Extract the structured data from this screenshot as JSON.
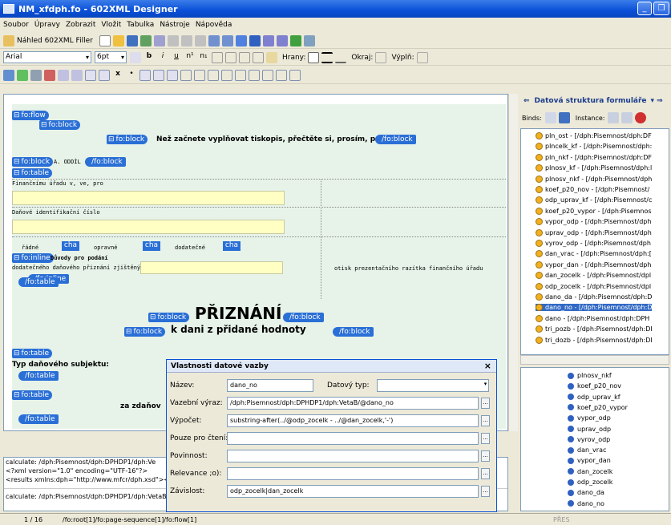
{
  "window": {
    "title": "NM_xfdph.fo - 602XML Designer"
  },
  "menu": [
    "Soubor",
    "Úpravy",
    "Zobrazit",
    "Vložit",
    "Tabulka",
    "Nástroje",
    "Nápověda"
  ],
  "toolbar1": {
    "preview_label": "Náhled 602XML Filler"
  },
  "toolbar2": {
    "font": "Arial",
    "size": "6pt",
    "borders_label": "Hrany:",
    "margin_label": "Okraj:",
    "fill_label": "Výplň:"
  },
  "editor": {
    "tags": {
      "flow": "fo:flow",
      "block": "fo:block",
      "block_end": "/fo:block",
      "table": "fo:table",
      "table_end": "/fo:table",
      "inline": "fo:inline",
      "inline_end": "/fo:inline"
    },
    "intro_text": "Než začnete vyplňovat tiskopis, přečtěte si, prosím, pokyny.",
    "section_a": "A. ODDÍL",
    "financni_urad": "Finančnímu úřadu v, ve, pro",
    "dic": "Daňové identifikační číslo",
    "radne": "řádné",
    "opravne": "opravné",
    "dodatecne": "dodatečné",
    "cha": "cha",
    "duvody": "Důvody pro podání",
    "dodatecne_zjisteny": "dodatečného daňového přiznání zjištěný",
    "otisk": "otisk prezentačního razítka finančního úřadu",
    "priznani": "PŘIZNÁNÍ",
    "k_dani": "k dani z přidané hodnoty",
    "typ_subjektu": "Typ daňového subjektu:",
    "za_zdanovaci": "za zdaňov"
  },
  "dialog": {
    "title": "Vlastnosti datové vazby",
    "close": "×",
    "name_label": "Název:",
    "name_value": "dano_no",
    "datatype_label": "Datový typ:",
    "datatype_value": "",
    "binding_label": "Vazební výraz:",
    "binding_value": "/dph:Pisemnost/dph:DPHDP1/dph:VetaB/@dano_no",
    "calc_label": "Výpočet:",
    "calc_value": "substring-after(../@odp_zocelk - ../@dan_zocelk,'-')",
    "readonly_label": "Pouze pro čtení:",
    "readonly_value": "",
    "required_label": "Povinnost:",
    "required_value": "",
    "relevance_label": "Relevance ;o):",
    "relevance_value": "",
    "dependency_label": "Závislost:",
    "dependency_value": "odp_zocelk|dan_zocelk",
    "browse": "..."
  },
  "rightpanel": {
    "title": "Datová struktura formuláře",
    "binds_label": "Binds:",
    "instance_label": "Instance:",
    "tree": [
      "pln_ost - [/dph:Pisemnost/dph:DF",
      "plncelk_kf - [/dph:Pisemnost/dph:",
      "pln_nkf - [/dph:Pisemnost/dph:DF",
      "plnosv_kf - [/dph:Pisemnost/dph:l",
      "plnosv_nkf - [/dph:Pisemnost/dph",
      "koef_p20_nov - [/dph:Pisemnost/",
      "odp_uprav_kf - [/dph:Pisemnost/c",
      "koef_p20_vypor - [/dph:Pisemnos",
      "vypor_odp - [/dph:Pisemnost/dph",
      "uprav_odp - [/dph:Pisemnost/dph",
      "vyrov_odp - [/dph:Pisemnost/dph",
      "dan_vrac - [/dph:Pisemnost/dph:[",
      "vypor_dan - [/dph:Pisemnost/dph",
      "dan_zocelk - [/dph:Pisemnost/dpl",
      "odp_zocelk - [/dph:Pisemnost/dpl",
      "dano_da - [/dph:Pisemnost/dph:D",
      "dano_no - [/dph:Pisemnost/dph:D",
      "dano - [/dph:Pisemnost/dph:DPH",
      "tri_pozb - [/dph:Pisemnost/dph:DI",
      "tri_dozb - [/dph:Pisemnost/dph:DI"
    ],
    "selected_index": 16,
    "leaves": [
      "plnosv_nkf",
      "koef_p20_nov",
      "odp_uprav_kf",
      "koef_p20_vypor",
      "vypor_odp",
      "uprav_odp",
      "vyrov_odp",
      "dan_vrac",
      "vypor_dan",
      "dan_zocelk",
      "odp_zocelk",
      "dano_da",
      "dano_no"
    ]
  },
  "bottom": {
    "line1": "calculate: /dph:Pisemnost/dph:DPHDP1/dph:Ve",
    "line2": "<?xml version=\"1.0\" encoding=\"UTF-16\"?>",
    "line3": "<results xmlns:dph=\"http://www.mfcr/dph.xsd\"><",
    "line4": "calculate: /dph:Pisemnost/dph:DPHDP1/dph:VetaB/@jmeno"
  },
  "status": {
    "page": "1 / 16",
    "path": "/fo:root[1]/fo:page-sequence[1]/fo:flow[1]",
    "mode": "PŘES"
  }
}
